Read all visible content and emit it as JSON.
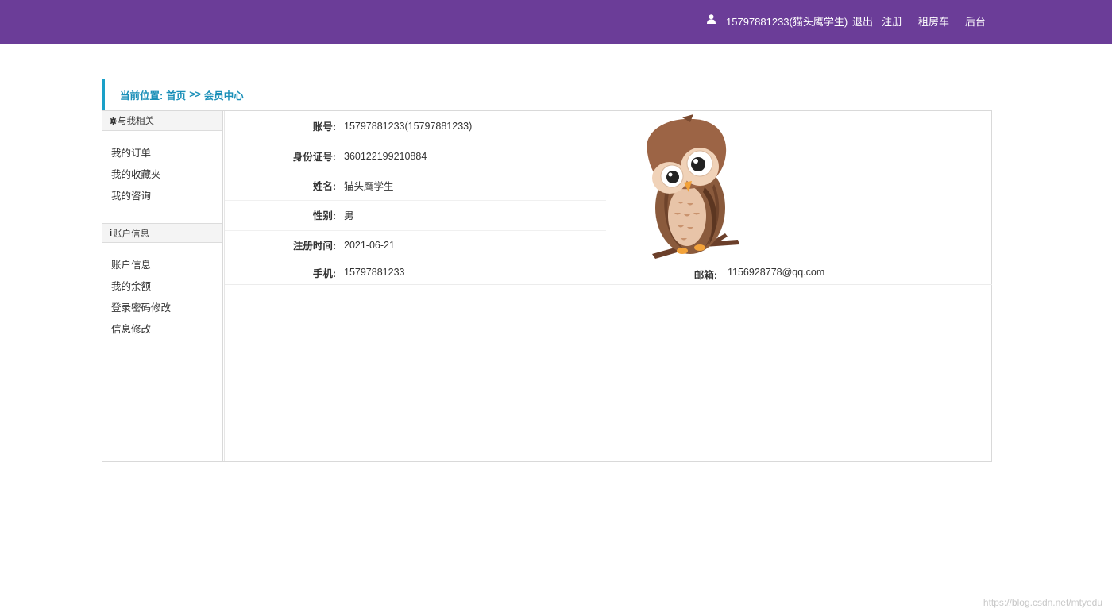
{
  "header": {
    "user_display": "15797881233(猫头鹰学生)",
    "logout": "退出",
    "register": "注册",
    "rent_car": "租房车",
    "admin": "后台",
    "bg_color": "#6b3d98"
  },
  "breadcrumb": {
    "prefix": "当前位置:",
    "home": "首页",
    "separator": ">>",
    "current": "会员中心"
  },
  "sidebar": {
    "section1_title": "与我相关",
    "section1_icon": "gear-icon",
    "section1_items": [
      "我的订单",
      "我的收藏夹",
      "我的咨询"
    ],
    "section2_title": "账户信息",
    "section2_icon": "info-icon",
    "section2_items": [
      "账户信息",
      "我的余额",
      "登录密码修改",
      "信息修改"
    ]
  },
  "profile": {
    "account_label": "账号:",
    "account_value": "15797881233(15797881233)",
    "idcard_label": "身份证号:",
    "idcard_value": "360122199210884",
    "name_label": "姓名:",
    "name_value": "猫头鹰学生",
    "gender_label": "性别:",
    "gender_value": "男",
    "regtime_label": "注册时间:",
    "regtime_value": "2021-06-21",
    "phone_label": "手机:",
    "phone_value": "15797881233",
    "email_label": "邮箱:",
    "email_value": "1156928778@qq.com",
    "avatar": "owl-avatar"
  },
  "footer": {
    "watermark": "https://blog.csdn.net/mtyedu"
  }
}
